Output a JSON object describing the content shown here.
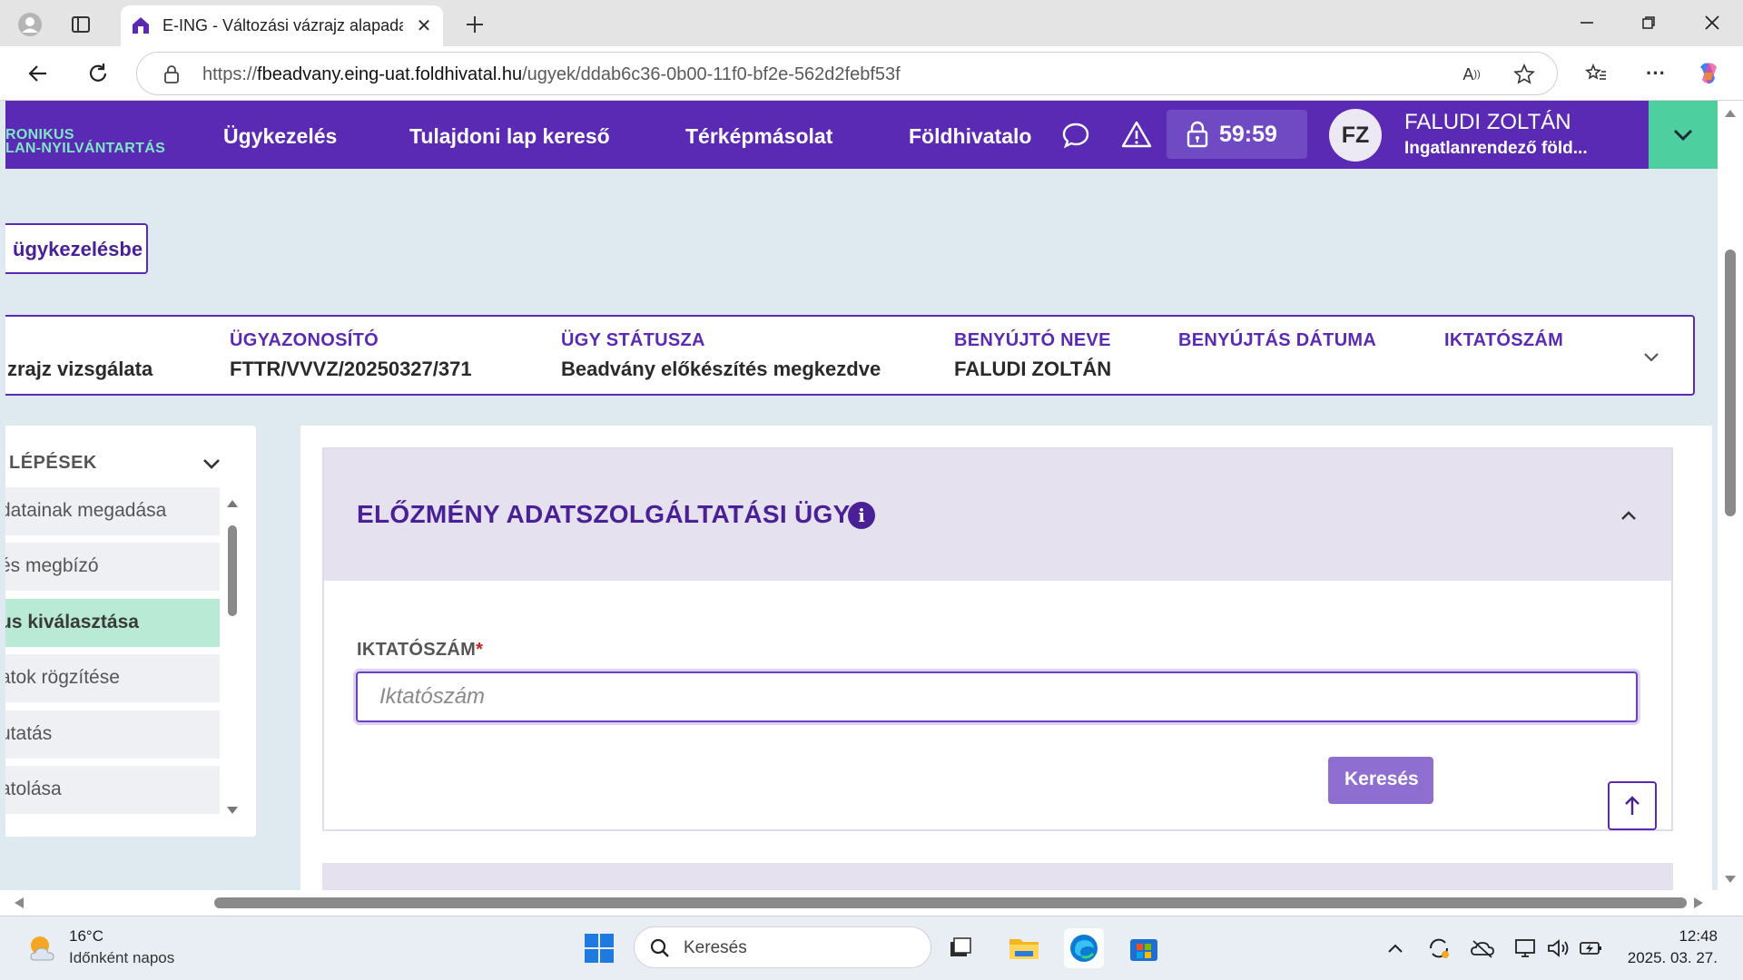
{
  "browser": {
    "tab_title": "E-ING - Változási vázrajz alapadat",
    "url_prefix": "https://",
    "url_host": "fbeadvany.eing-uat.foldhivatal.hu",
    "url_path": "/ugyek/ddab6c36-0b00-11f0-bf2e-562d2febf53f"
  },
  "header": {
    "logo_line1": "RONIKUS",
    "logo_line2": "LAN-NYILVÁNTARTÁS",
    "nav": [
      "Ügykezelés",
      "Tulajdoni lap kereső",
      "Térképmásolat",
      "Földhivatalo"
    ],
    "timer": "59:59",
    "avatar_initials": "FZ",
    "user_name": "FALUDI ZOLTÁN",
    "user_org": "Ingatlanrendező föld..."
  },
  "back_button": "ügykezelésbe",
  "case_info": {
    "first_value": "zrajz vizsgálata",
    "fields": [
      {
        "label": "ÜGYAZONOSÍTÓ",
        "value": "FTTR/VVVZ/20250327/371"
      },
      {
        "label": "ÜGY STÁTUSZA",
        "value": "Beadvány előkészítés megkezdve"
      },
      {
        "label": "BENYÚJTÓ NEVE",
        "value": "FALUDI ZOLTÁN"
      },
      {
        "label": "BENYÚJTÁS DÁTUMA",
        "value": ""
      },
      {
        "label": "IKTATÓSZÁM",
        "value": ""
      }
    ]
  },
  "steps": {
    "title": "LÉPÉSEK",
    "items": [
      {
        "label": "datainak megadása",
        "active": false
      },
      {
        "label": "és megbízó",
        "active": false
      },
      {
        "label": "us kiválasztása",
        "active": true
      },
      {
        "label": "atok rögzítése",
        "active": false
      },
      {
        "label": "utatás",
        "active": false
      },
      {
        "label": "atolása",
        "active": false
      }
    ]
  },
  "section": {
    "title": "ELŐZMÉNY ADATSZOLGÁLTATÁSI ÜGY",
    "field_label": "IKTATÓSZÁM",
    "required_mark": "*",
    "input_placeholder": "Iktatószám",
    "input_value": "",
    "search_button": "Keresés"
  },
  "taskbar": {
    "weather_temp": "16°C",
    "weather_desc": "Időnként napos",
    "search_placeholder": "Keresés",
    "time": "12:48",
    "date": "2025. 03. 27."
  },
  "colors": {
    "brand_purple": "#5b2ab5",
    "accent_green": "#4ecfa0",
    "active_step": "#b9ead6",
    "required_red": "#d0201a"
  }
}
